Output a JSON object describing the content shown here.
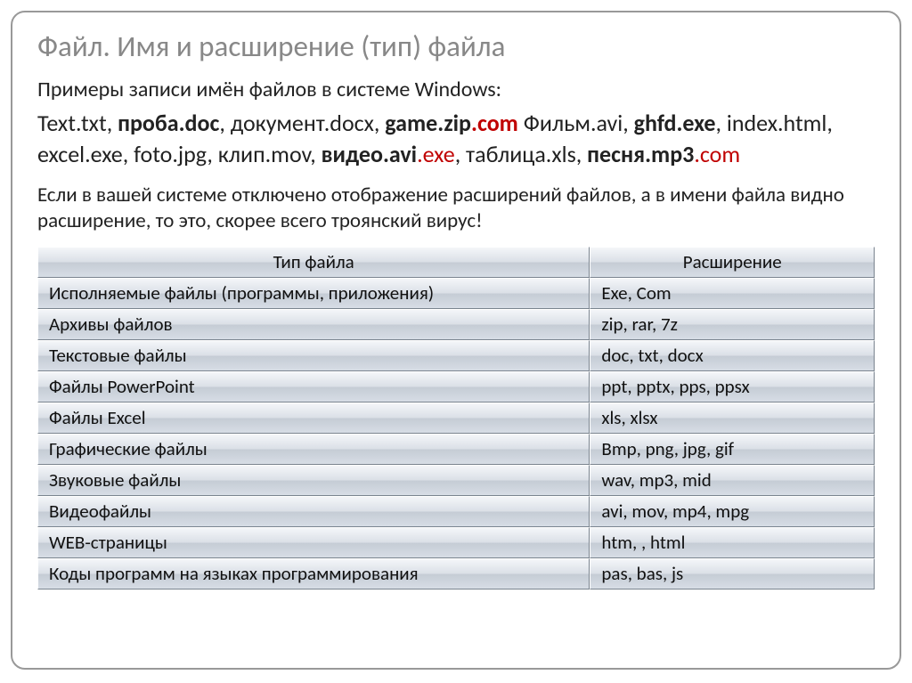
{
  "title": "Файл. Имя и расширение (тип) файла",
  "intro": "Примеры записи имён файлов в системе Windows:",
  "examples": [
    {
      "t": "Text.txt, ",
      "b": false,
      "r": false
    },
    {
      "t": "проба.doc",
      "b": true,
      "r": false
    },
    {
      "t": ", документ.docx, ",
      "b": false,
      "r": false
    },
    {
      "t": "game.zip",
      "b": true,
      "r": false
    },
    {
      "t": ".com",
      "b": true,
      "r": true
    },
    {
      "t": " Фильм.avi, ",
      "b": false,
      "r": false
    },
    {
      "t": "ghfd.exe",
      "b": true,
      "r": false
    },
    {
      "t": ", index.html, excel.exe, foto.jpg, клип.mov, ",
      "b": false,
      "r": false
    },
    {
      "t": "видео.avi",
      "b": true,
      "r": false
    },
    {
      "t": ".exe",
      "b": false,
      "r": true
    },
    {
      "t": ", таблица.xls, ",
      "b": false,
      "r": false
    },
    {
      "t": "песня.mp3",
      "b": true,
      "r": false
    },
    {
      "t": ".com",
      "b": false,
      "r": true
    }
  ],
  "warning": "Если в вашей системе отключено отображение расширений файлов, а в имени файла видно расширение, то это, скорее всего троянский вирус!",
  "table": {
    "headers": {
      "col1": "Тип файла",
      "col2": "Расширение"
    },
    "rows": [
      {
        "type": "Исполняемые файлы (программы, приложения)",
        "ext": "Exe, Com"
      },
      {
        "type": "Архивы файлов",
        "ext": "zip, rar, 7z"
      },
      {
        "type": "Текстовые файлы",
        "ext": "doc, txt, docx"
      },
      {
        "type": "Файлы PowerPoint",
        "ext": "ppt, pptx, pps, ppsx"
      },
      {
        "type": "Файлы Excel",
        "ext": "xls, xlsx"
      },
      {
        "type": "Графические файлы",
        "ext": "Bmp, png, jpg, gif"
      },
      {
        "type": "Звуковые файлы",
        "ext": "wav, mp3, mid"
      },
      {
        "type": "Видеофайлы",
        "ext": "avi, mov, mp4, mpg"
      },
      {
        "type": "WEB-страницы",
        "ext": "htm, , html"
      },
      {
        "type": "Коды программ на языках программирования",
        "ext": "pas, bas, js"
      }
    ]
  }
}
